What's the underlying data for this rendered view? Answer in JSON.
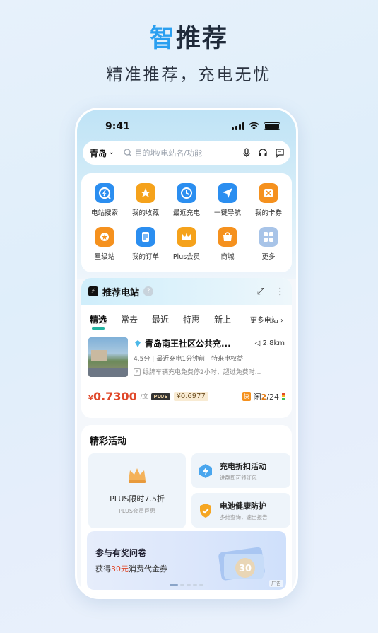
{
  "hero": {
    "accent": "智",
    "title_rest": "推荐",
    "subtitle": "精准推荐，充电无忧"
  },
  "status_bar": {
    "time": "9:41"
  },
  "search": {
    "city": "青岛",
    "placeholder": "目的地/电站名/功能"
  },
  "quick_grid": [
    {
      "label": "电站搜索",
      "icon": "search-station-icon",
      "color": "#2b8ef0"
    },
    {
      "label": "我的收藏",
      "icon": "star-icon",
      "color": "#f5a21b"
    },
    {
      "label": "最近充电",
      "icon": "clock-icon",
      "color": "#2b8ef0"
    },
    {
      "label": "一键导航",
      "icon": "navigation-icon",
      "color": "#2b8ef0"
    },
    {
      "label": "我的卡券",
      "icon": "coupon-icon",
      "color": "#f5911e"
    },
    {
      "label": "星级站",
      "icon": "star-station-icon",
      "color": "#f5911e"
    },
    {
      "label": "我的订单",
      "icon": "order-icon",
      "color": "#2b8ef0"
    },
    {
      "label": "Plus会员",
      "icon": "crown-icon",
      "color": "#f5a21b"
    },
    {
      "label": "商城",
      "icon": "shop-icon",
      "color": "#f5911e"
    },
    {
      "label": "更多",
      "icon": "grid-more-icon",
      "color": "#a8c4e8"
    }
  ],
  "recommend": {
    "title": "推荐电站",
    "tabs": [
      "精选",
      "常去",
      "最近",
      "特惠",
      "新上"
    ],
    "more_label": "更多电站",
    "station": {
      "name": "青岛南王社区公共充...",
      "distance": "2.8km",
      "rating": "4.5分",
      "recent": "最近充电1分钟前",
      "benefit": "特来电权益",
      "note": "绿牌车辆充电免费停2小时，超过免费时...",
      "price": "0.7300",
      "price_unit": "/度",
      "currency": "¥",
      "plus_badge": "PLUS",
      "plus_price": "¥0.6977",
      "fast_tag": "快",
      "idle_label": "闲",
      "idle": "2",
      "total": "/24"
    }
  },
  "activities": {
    "title": "精彩活动",
    "plus": {
      "title": "PLUS限时7.5折",
      "sub": "PLUS会员巨惠"
    },
    "items": [
      {
        "title": "充电折扣活动",
        "sub": "进群即可领红包"
      },
      {
        "title": "电池健康防护",
        "sub": "多维查询，速出报告"
      }
    ],
    "banner": {
      "title": "参与有奖问卷",
      "sub_prefix": "获得",
      "sub_amount": "30元",
      "sub_suffix": "消费代金券",
      "ad": "广告",
      "coupon_value": "30"
    }
  }
}
